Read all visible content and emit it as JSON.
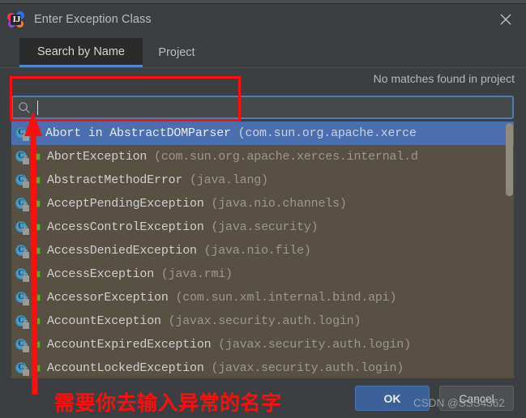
{
  "window": {
    "title": "Enter Exception Class",
    "app_icon": "intellij-idea-icon",
    "close_icon": "close-icon"
  },
  "tabs": [
    {
      "label": "Search by Name",
      "active": true
    },
    {
      "label": "Project",
      "active": false
    }
  ],
  "status": {
    "no_matches": "No matches found in project"
  },
  "search": {
    "icon": "search-icon",
    "value": "",
    "placeholder": ""
  },
  "results": [
    {
      "name": "Abort in AbstractDOMParser",
      "package": "(com.sun.org.apache.xerce",
      "selected": true,
      "mark": "hollow"
    },
    {
      "name": "AbortException",
      "package": "(com.sun.org.apache.xerces.internal.d",
      "selected": false,
      "mark": "solid"
    },
    {
      "name": "AbstractMethodError",
      "package": "(java.lang)",
      "selected": false,
      "mark": "solid"
    },
    {
      "name": "AcceptPendingException",
      "package": "(java.nio.channels)",
      "selected": false,
      "mark": "solid"
    },
    {
      "name": "AccessControlException",
      "package": "(java.security)",
      "selected": false,
      "mark": "solid"
    },
    {
      "name": "AccessDeniedException",
      "package": "(java.nio.file)",
      "selected": false,
      "mark": "solid"
    },
    {
      "name": "AccessException",
      "package": "(java.rmi)",
      "selected": false,
      "mark": "solid"
    },
    {
      "name": "AccessorException",
      "package": "(com.sun.xml.internal.bind.api)",
      "selected": false,
      "mark": "solid"
    },
    {
      "name": "AccountException",
      "package": "(javax.security.auth.login)",
      "selected": false,
      "mark": "solid"
    },
    {
      "name": "AccountExpiredException",
      "package": "(javax.security.auth.login)",
      "selected": false,
      "mark": "solid"
    },
    {
      "name": "AccountLockedException",
      "package": "(javax.security.auth.login)",
      "selected": false,
      "mark": "solid"
    }
  ],
  "buttons": {
    "ok": "OK",
    "cancel": "Cancel"
  },
  "annotations": {
    "note": "需要你去输入异常的名字",
    "watermark": "CSDN @SSS4362",
    "color": "#fd0d0d"
  },
  "colors": {
    "dialog_bg": "#3c3f41",
    "tab_active_bg": "#2b2b2b",
    "tab_underline": "#4a88c7",
    "list_bg": "#575043",
    "row_selected": "#4b6eaf",
    "search_border": "#4f7cb0",
    "ok_button": "#3c6198",
    "cancel_button": "#4c5052"
  }
}
